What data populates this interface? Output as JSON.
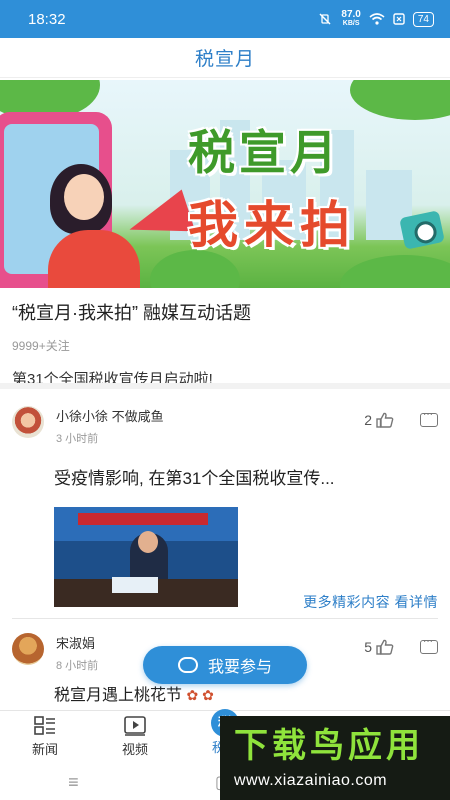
{
  "status_bar": {
    "time": "18:32",
    "speed_value": "87.0",
    "speed_unit": "KB/S",
    "battery": "74"
  },
  "header": {
    "title": "税宣月"
  },
  "banner": {
    "line1": "税宣月",
    "line2": "我来拍"
  },
  "topic": {
    "title": "“税宣月·我来拍” 融媒互动话题",
    "follow_count": "9999+关注",
    "description": "第31个全国税收宣传月启动啦!"
  },
  "posts": [
    {
      "author": "小徐小徐  不做咸鱼",
      "time": "3 小时前",
      "likes": "2",
      "text": "受疫情影响, 在第31个全国税收宣传..."
    },
    {
      "author": "宋淑娟",
      "time": "8 小时前",
      "likes": "5",
      "text": "税宣月遇上桃花节"
    }
  ],
  "more_link": "更多精彩内容 看详情",
  "join_button": "我要参与",
  "bottom_nav": [
    {
      "label": "新闻",
      "icon": "news-grid-icon"
    },
    {
      "label": "视频",
      "icon": "video-play-icon"
    },
    {
      "label": "税宣",
      "icon": "shui-badge-icon"
    }
  ],
  "watermark": {
    "title": "下载鸟应用",
    "url": "www.xiazainiao.com"
  },
  "colors": {
    "accent": "#2f8fd8",
    "link": "#2e7fc8"
  }
}
